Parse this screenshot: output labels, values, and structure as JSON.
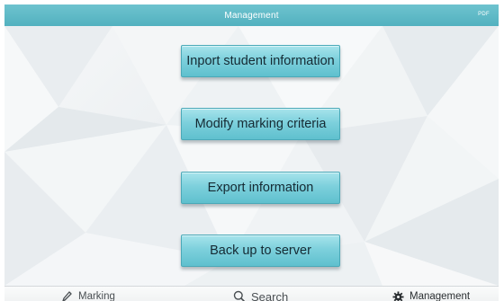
{
  "header": {
    "title": "Management",
    "corner_label": "PDF"
  },
  "actions": [
    {
      "label": "Inport student information"
    },
    {
      "label": "Modify marking criteria"
    },
    {
      "label": "Export information"
    },
    {
      "label": "Back up to server"
    }
  ],
  "tabbar": {
    "tabs": [
      {
        "label": "Marking",
        "icon": "pencil-icon"
      },
      {
        "label": "Search",
        "icon": "search-icon"
      },
      {
        "label": "Management",
        "icon": "gear-icon",
        "active": true
      }
    ]
  },
  "colors": {
    "header": "#52b1bf",
    "button": "#7dd0dc",
    "background": "#eef1f3"
  }
}
